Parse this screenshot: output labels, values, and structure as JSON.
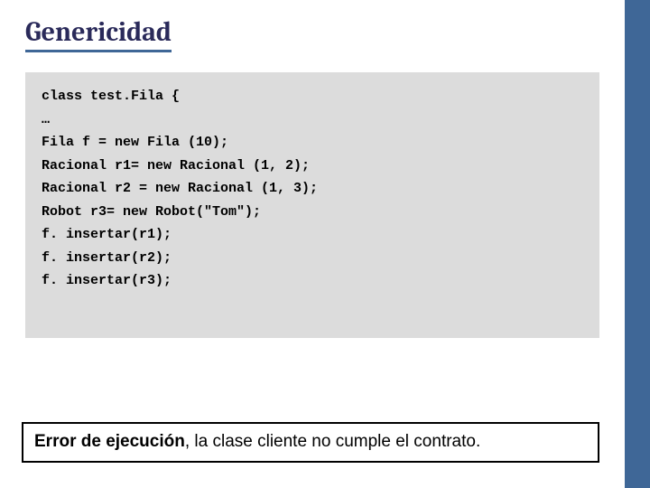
{
  "title": "Genericidad",
  "code": "class test.Fila {\n…\nFila f = new Fila (10);\nRacional r1= new Racional (1, 2);\nRacional r2 = new Racional (1, 3);\nRobot r3= new Robot(\"Tom\");\nf. insertar(r1);\nf. insertar(r2);\nf. insertar(r3);",
  "error": {
    "bold": "Error de ejecución",
    "rest": ", la clase cliente no cumple el contrato."
  }
}
